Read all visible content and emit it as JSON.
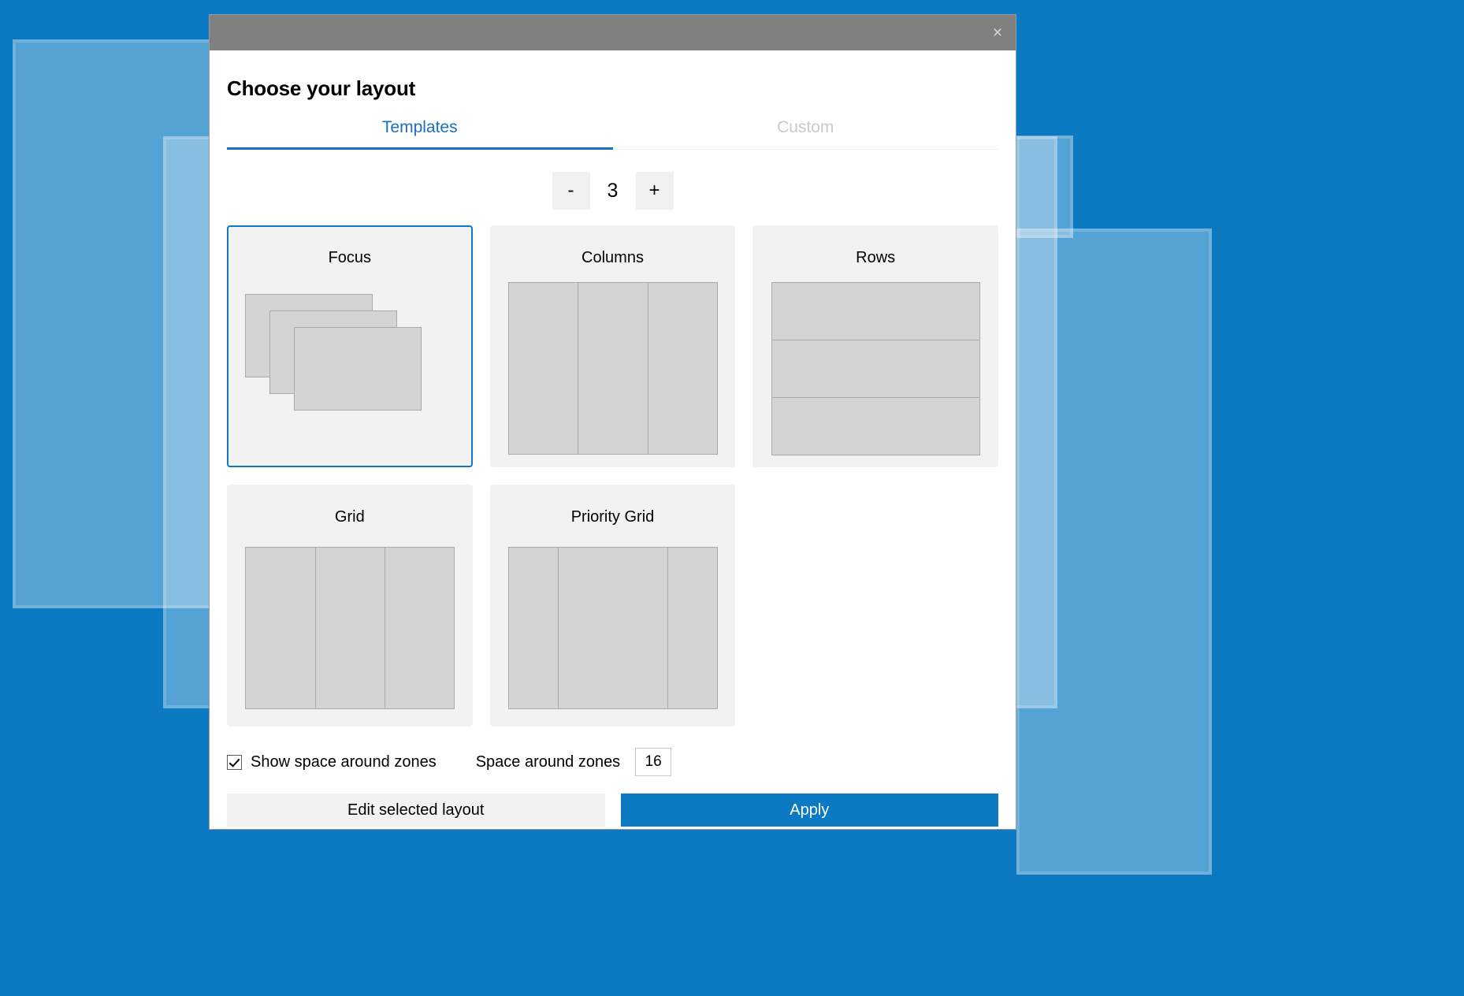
{
  "window": {
    "title_bar_color": "#808080",
    "close_icon": "×",
    "close_label": "Close"
  },
  "dialog": {
    "title": "Choose your layout"
  },
  "tabs": [
    {
      "label": "Templates",
      "active": true
    },
    {
      "label": "Custom",
      "active": false
    }
  ],
  "stepper": {
    "decrement_label": "-",
    "value": "3",
    "increment_label": "+"
  },
  "templates": [
    {
      "name": "Focus",
      "preview": "cascade",
      "selected": true
    },
    {
      "name": "Columns",
      "preview": "columns",
      "selected": false
    },
    {
      "name": "Rows",
      "preview": "rows",
      "selected": false
    },
    {
      "name": "Grid",
      "preview": "grid",
      "selected": false
    },
    {
      "name": "Priority Grid",
      "preview": "priority",
      "selected": false
    }
  ],
  "options": {
    "show_space_checkbox_label": "Show space around zones",
    "show_space_checked": true,
    "space_label": "Space around zones",
    "space_value": "16"
  },
  "actions": {
    "edit_label": "Edit selected layout",
    "apply_label": "Apply"
  },
  "colors": {
    "accent": "#0c7ac2",
    "desktop": "#0c7ac2",
    "tab_active": "#1a6fc4",
    "tab_inactive": "#c9c9c9",
    "card_bg": "#f2f2f2",
    "pane_fill": "#d4d4d4",
    "pane_border": "#aaaaaa"
  }
}
